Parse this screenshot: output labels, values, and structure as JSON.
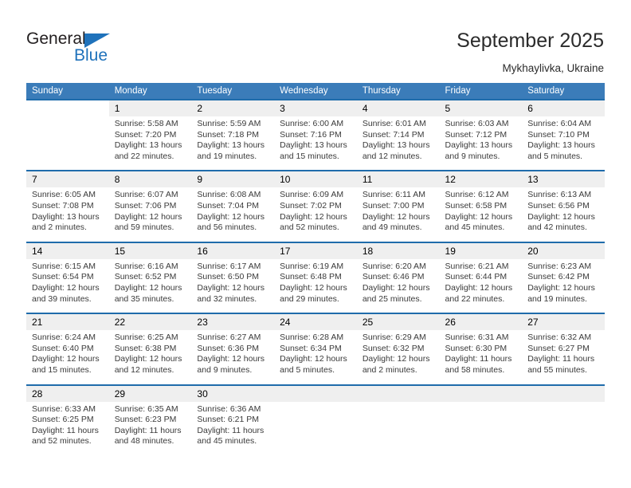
{
  "brand": {
    "name_part1": "General",
    "name_part2": "Blue",
    "triangle_color": "#1f72bb"
  },
  "header": {
    "title": "September 2025",
    "location": "Mykhaylivka, Ukraine"
  },
  "theme": {
    "header_row_bg": "#3b7cb9",
    "daynum_bg": "#efefef",
    "row_border": "#1f6cab"
  },
  "weekdays": [
    "Sunday",
    "Monday",
    "Tuesday",
    "Wednesday",
    "Thursday",
    "Friday",
    "Saturday"
  ],
  "weeks": [
    {
      "days": [
        {
          "num": "",
          "sunrise": "",
          "sunset": "",
          "daylight1": "",
          "daylight2": ""
        },
        {
          "num": "1",
          "sunrise": "Sunrise: 5:58 AM",
          "sunset": "Sunset: 7:20 PM",
          "daylight1": "Daylight: 13 hours",
          "daylight2": "and 22 minutes."
        },
        {
          "num": "2",
          "sunrise": "Sunrise: 5:59 AM",
          "sunset": "Sunset: 7:18 PM",
          "daylight1": "Daylight: 13 hours",
          "daylight2": "and 19 minutes."
        },
        {
          "num": "3",
          "sunrise": "Sunrise: 6:00 AM",
          "sunset": "Sunset: 7:16 PM",
          "daylight1": "Daylight: 13 hours",
          "daylight2": "and 15 minutes."
        },
        {
          "num": "4",
          "sunrise": "Sunrise: 6:01 AM",
          "sunset": "Sunset: 7:14 PM",
          "daylight1": "Daylight: 13 hours",
          "daylight2": "and 12 minutes."
        },
        {
          "num": "5",
          "sunrise": "Sunrise: 6:03 AM",
          "sunset": "Sunset: 7:12 PM",
          "daylight1": "Daylight: 13 hours",
          "daylight2": "and 9 minutes."
        },
        {
          "num": "6",
          "sunrise": "Sunrise: 6:04 AM",
          "sunset": "Sunset: 7:10 PM",
          "daylight1": "Daylight: 13 hours",
          "daylight2": "and 5 minutes."
        }
      ]
    },
    {
      "days": [
        {
          "num": "7",
          "sunrise": "Sunrise: 6:05 AM",
          "sunset": "Sunset: 7:08 PM",
          "daylight1": "Daylight: 13 hours",
          "daylight2": "and 2 minutes."
        },
        {
          "num": "8",
          "sunrise": "Sunrise: 6:07 AM",
          "sunset": "Sunset: 7:06 PM",
          "daylight1": "Daylight: 12 hours",
          "daylight2": "and 59 minutes."
        },
        {
          "num": "9",
          "sunrise": "Sunrise: 6:08 AM",
          "sunset": "Sunset: 7:04 PM",
          "daylight1": "Daylight: 12 hours",
          "daylight2": "and 56 minutes."
        },
        {
          "num": "10",
          "sunrise": "Sunrise: 6:09 AM",
          "sunset": "Sunset: 7:02 PM",
          "daylight1": "Daylight: 12 hours",
          "daylight2": "and 52 minutes."
        },
        {
          "num": "11",
          "sunrise": "Sunrise: 6:11 AM",
          "sunset": "Sunset: 7:00 PM",
          "daylight1": "Daylight: 12 hours",
          "daylight2": "and 49 minutes."
        },
        {
          "num": "12",
          "sunrise": "Sunrise: 6:12 AM",
          "sunset": "Sunset: 6:58 PM",
          "daylight1": "Daylight: 12 hours",
          "daylight2": "and 45 minutes."
        },
        {
          "num": "13",
          "sunrise": "Sunrise: 6:13 AM",
          "sunset": "Sunset: 6:56 PM",
          "daylight1": "Daylight: 12 hours",
          "daylight2": "and 42 minutes."
        }
      ]
    },
    {
      "days": [
        {
          "num": "14",
          "sunrise": "Sunrise: 6:15 AM",
          "sunset": "Sunset: 6:54 PM",
          "daylight1": "Daylight: 12 hours",
          "daylight2": "and 39 minutes."
        },
        {
          "num": "15",
          "sunrise": "Sunrise: 6:16 AM",
          "sunset": "Sunset: 6:52 PM",
          "daylight1": "Daylight: 12 hours",
          "daylight2": "and 35 minutes."
        },
        {
          "num": "16",
          "sunrise": "Sunrise: 6:17 AM",
          "sunset": "Sunset: 6:50 PM",
          "daylight1": "Daylight: 12 hours",
          "daylight2": "and 32 minutes."
        },
        {
          "num": "17",
          "sunrise": "Sunrise: 6:19 AM",
          "sunset": "Sunset: 6:48 PM",
          "daylight1": "Daylight: 12 hours",
          "daylight2": "and 29 minutes."
        },
        {
          "num": "18",
          "sunrise": "Sunrise: 6:20 AM",
          "sunset": "Sunset: 6:46 PM",
          "daylight1": "Daylight: 12 hours",
          "daylight2": "and 25 minutes."
        },
        {
          "num": "19",
          "sunrise": "Sunrise: 6:21 AM",
          "sunset": "Sunset: 6:44 PM",
          "daylight1": "Daylight: 12 hours",
          "daylight2": "and 22 minutes."
        },
        {
          "num": "20",
          "sunrise": "Sunrise: 6:23 AM",
          "sunset": "Sunset: 6:42 PM",
          "daylight1": "Daylight: 12 hours",
          "daylight2": "and 19 minutes."
        }
      ]
    },
    {
      "days": [
        {
          "num": "21",
          "sunrise": "Sunrise: 6:24 AM",
          "sunset": "Sunset: 6:40 PM",
          "daylight1": "Daylight: 12 hours",
          "daylight2": "and 15 minutes."
        },
        {
          "num": "22",
          "sunrise": "Sunrise: 6:25 AM",
          "sunset": "Sunset: 6:38 PM",
          "daylight1": "Daylight: 12 hours",
          "daylight2": "and 12 minutes."
        },
        {
          "num": "23",
          "sunrise": "Sunrise: 6:27 AM",
          "sunset": "Sunset: 6:36 PM",
          "daylight1": "Daylight: 12 hours",
          "daylight2": "and 9 minutes."
        },
        {
          "num": "24",
          "sunrise": "Sunrise: 6:28 AM",
          "sunset": "Sunset: 6:34 PM",
          "daylight1": "Daylight: 12 hours",
          "daylight2": "and 5 minutes."
        },
        {
          "num": "25",
          "sunrise": "Sunrise: 6:29 AM",
          "sunset": "Sunset: 6:32 PM",
          "daylight1": "Daylight: 12 hours",
          "daylight2": "and 2 minutes."
        },
        {
          "num": "26",
          "sunrise": "Sunrise: 6:31 AM",
          "sunset": "Sunset: 6:30 PM",
          "daylight1": "Daylight: 11 hours",
          "daylight2": "and 58 minutes."
        },
        {
          "num": "27",
          "sunrise": "Sunrise: 6:32 AM",
          "sunset": "Sunset: 6:27 PM",
          "daylight1": "Daylight: 11 hours",
          "daylight2": "and 55 minutes."
        }
      ]
    },
    {
      "days": [
        {
          "num": "28",
          "sunrise": "Sunrise: 6:33 AM",
          "sunset": "Sunset: 6:25 PM",
          "daylight1": "Daylight: 11 hours",
          "daylight2": "and 52 minutes."
        },
        {
          "num": "29",
          "sunrise": "Sunrise: 6:35 AM",
          "sunset": "Sunset: 6:23 PM",
          "daylight1": "Daylight: 11 hours",
          "daylight2": "and 48 minutes."
        },
        {
          "num": "30",
          "sunrise": "Sunrise: 6:36 AM",
          "sunset": "Sunset: 6:21 PM",
          "daylight1": "Daylight: 11 hours",
          "daylight2": "and 45 minutes."
        },
        {
          "num": "",
          "sunrise": "",
          "sunset": "",
          "daylight1": "",
          "daylight2": ""
        },
        {
          "num": "",
          "sunrise": "",
          "sunset": "",
          "daylight1": "",
          "daylight2": ""
        },
        {
          "num": "",
          "sunrise": "",
          "sunset": "",
          "daylight1": "",
          "daylight2": ""
        },
        {
          "num": "",
          "sunrise": "",
          "sunset": "",
          "daylight1": "",
          "daylight2": ""
        }
      ]
    }
  ]
}
